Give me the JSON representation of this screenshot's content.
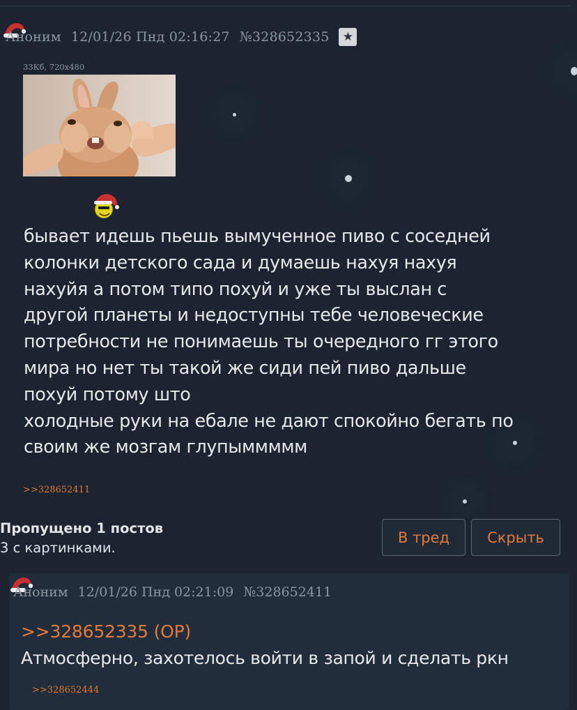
{
  "op_post": {
    "author": "Аноним",
    "date": "12/01/26 Пнд 02:16:27",
    "post_number": "№328652335",
    "file_info": "33Кб, 720x480",
    "body_lines": [
      "бывает идешь пьешь вымученное пиво с соседней",
      "колонки детского сада и думаешь нахуя нахуя",
      "нахуйя а потом типо похуй и уже ты выслан с",
      "другой планеты и недоступны тебе человеческие",
      "потребности не понимаешь ты очередного гг этого",
      "мира но нет ты такой же сиди пей пиво дальше",
      "похуй потому што",
      "холодные руки на ебале не дают спокойно бегать по",
      "своим же мозгам глупыммммм"
    ],
    "reply_link": ">>328652411",
    "icons": {
      "star": "star-icon",
      "hat": "santa-hat-icon",
      "emoji": "santa-smiley-icon",
      "thumbnail": "bunny-thumbnail"
    }
  },
  "skipped": {
    "line1": "Пропущено 1 постов",
    "line2": "3 с картинками."
  },
  "buttons": {
    "to_thread": "В тред",
    "hide": "Скрыть"
  },
  "reply_post": {
    "author": "Аноним",
    "date": "12/01/26 Пнд 02:21:09",
    "post_number": "№328652411",
    "quote_link": ">>328652335 (OP)",
    "text": "Атмосферно, захотелось войти в запой и сделать ркн",
    "reply_link": ">>328652444"
  },
  "colors": {
    "background": "#1b2430",
    "reply_background": "#212d3b",
    "link": "#e5793a",
    "meta": "#8d96a0",
    "text": "#e6e9ec"
  }
}
